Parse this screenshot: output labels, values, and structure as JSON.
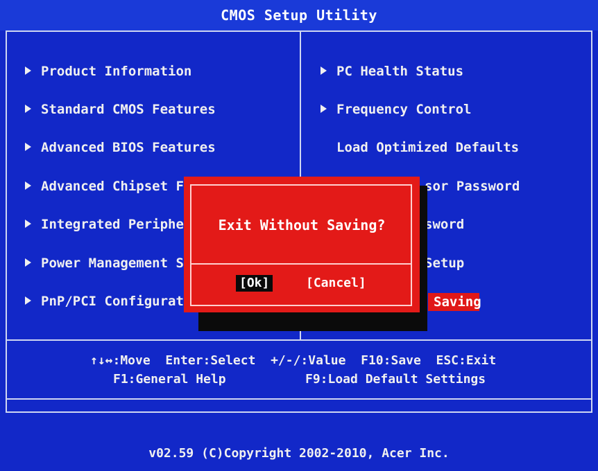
{
  "title": "CMOS Setup Utility",
  "left_menu": [
    {
      "label": "Product Information"
    },
    {
      "label": "Standard CMOS Features"
    },
    {
      "label": "Advanced BIOS Features"
    },
    {
      "label": "Advanced Chipset Fea"
    },
    {
      "label": "Integrated Periphera"
    },
    {
      "label": "Power Management Set"
    },
    {
      "label": "PnP/PCI Configuratio"
    }
  ],
  "right_menu": [
    {
      "label": "PC Health Status",
      "has_arrow": true
    },
    {
      "label": "Frequency Control",
      "has_arrow": true
    },
    {
      "label": "Load Optimized Defaults",
      "has_arrow": false
    },
    {
      "label": "sor Password",
      "has_arrow": false
    },
    {
      "label": "sword",
      "has_arrow": false
    },
    {
      "label": "Setup",
      "has_arrow": false
    },
    {
      "label": "Saving",
      "has_arrow": false,
      "selected": true
    }
  ],
  "dialog": {
    "message": "Exit Without Saving?",
    "ok_label": "[Ok]",
    "cancel_label": "[Cancel]"
  },
  "help": {
    "line1": "↑↓↔:Move  Enter:Select  +/-/:Value  F10:Save  ESC:Exit",
    "line2_left": "F1:General Help",
    "line2_right": "F9:Load Default Settings"
  },
  "copyright": "v02.59 (C)Copyright 2002-2010, Acer Inc.",
  "colors": {
    "background": "#1228c8",
    "dialog": "#e31a18",
    "highlight": "#e01818",
    "text": "#f0f0f0"
  }
}
